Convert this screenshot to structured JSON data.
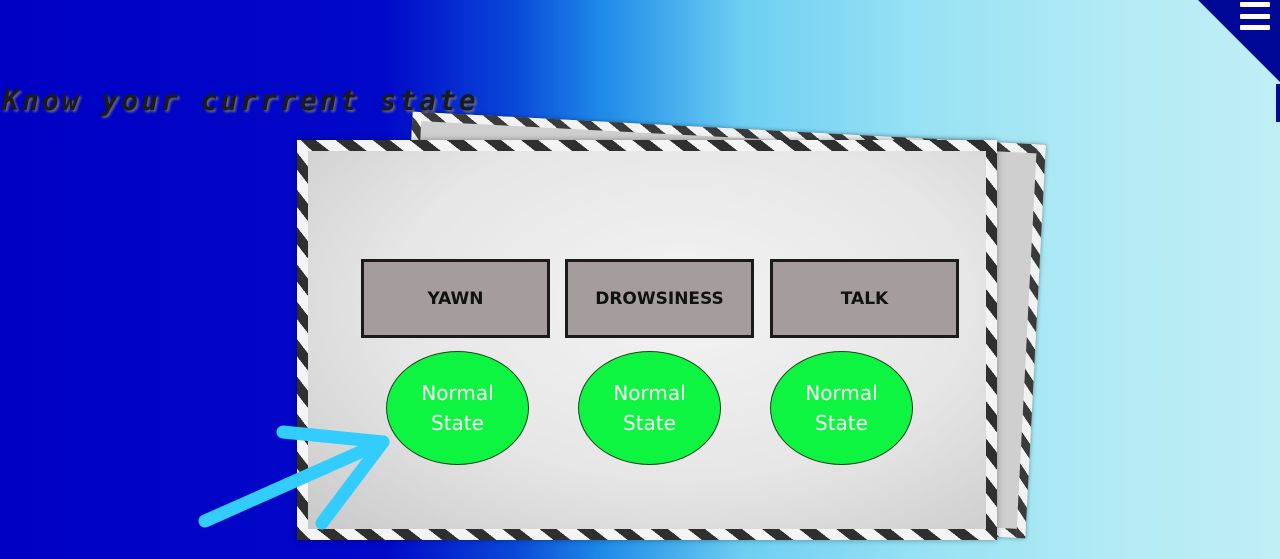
{
  "page": {
    "title": "Know your currrent state"
  },
  "header": {
    "menu_icon": "hamburger-menu-icon"
  },
  "states": [
    {
      "label": "YAWN",
      "status_line1": "Normal",
      "status_line2": "State"
    },
    {
      "label": "DROWSINESS",
      "status_line1": "Normal",
      "status_line2": "State"
    },
    {
      "label": "TALK",
      "status_line1": "Normal",
      "status_line2": "State"
    }
  ],
  "colors": {
    "status_normal": "#0df540",
    "label_box": "#a59d9d",
    "arrow": "#33ccff",
    "corner": "#000896"
  },
  "annotation": {
    "icon": "pointer-arrow-icon"
  }
}
